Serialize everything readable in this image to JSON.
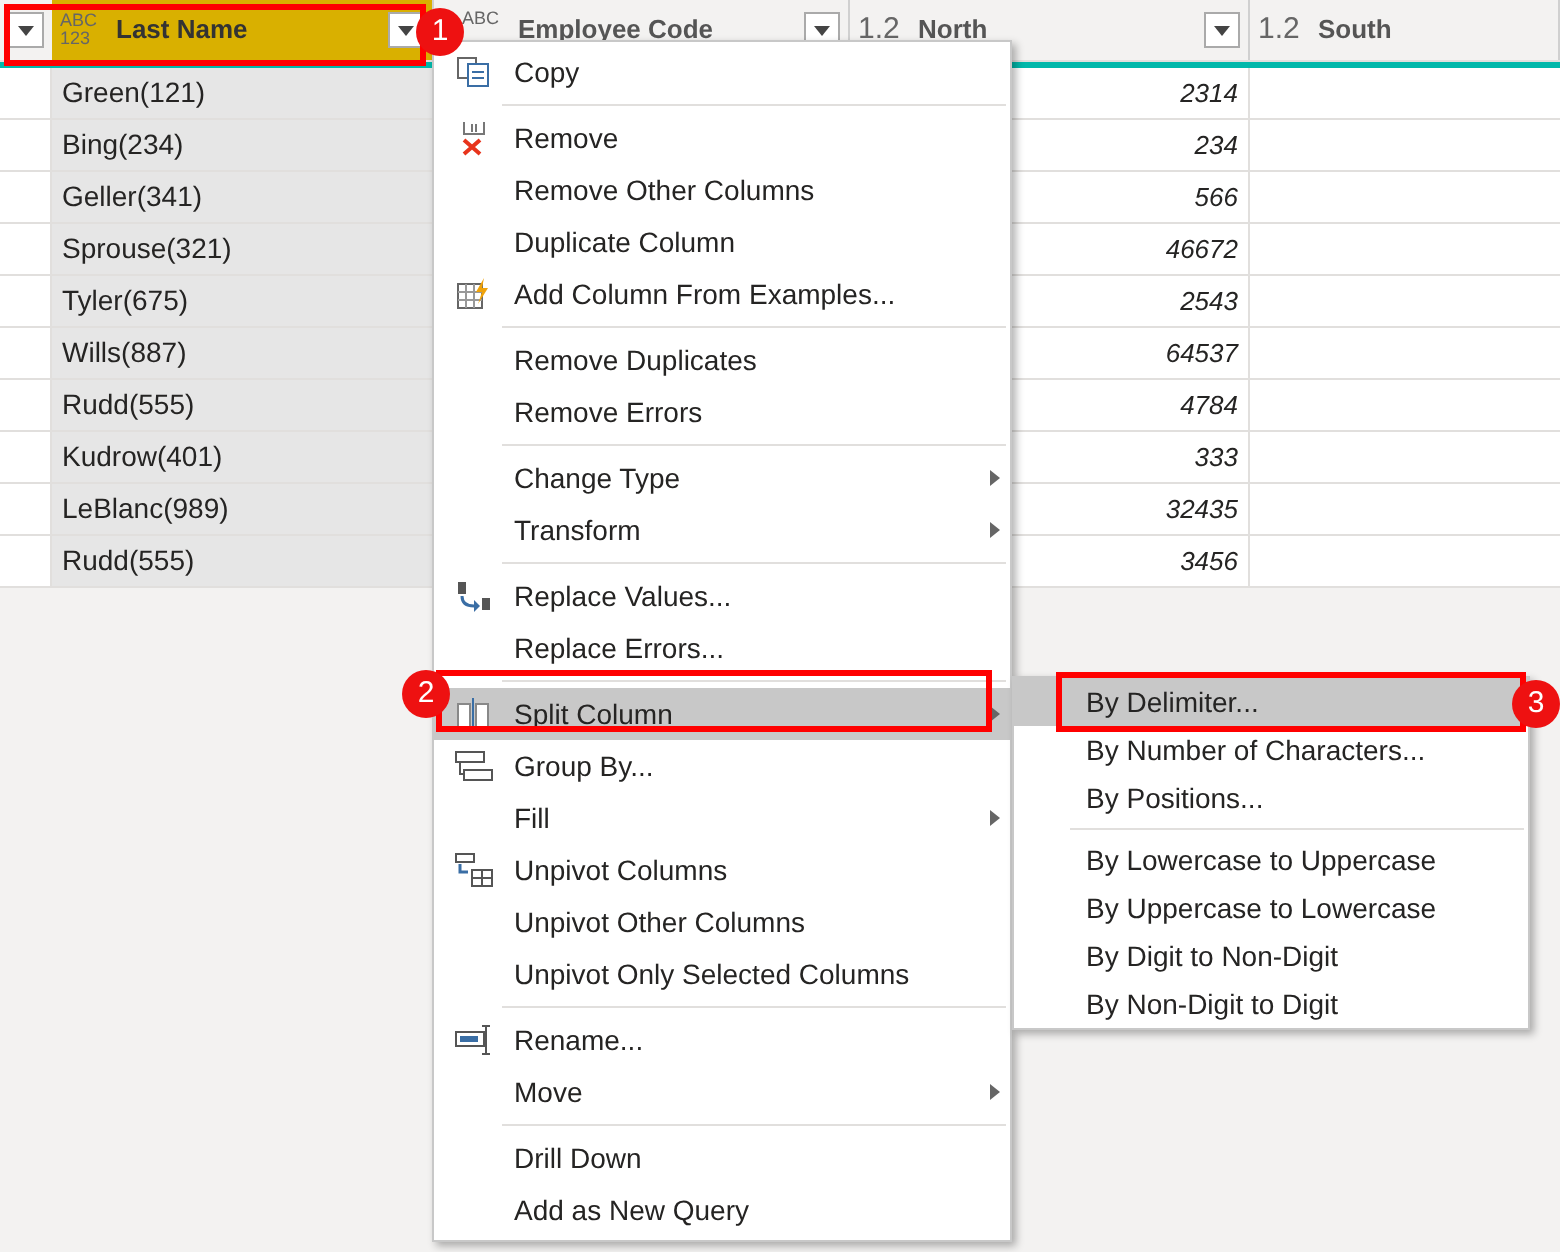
{
  "columns": [
    {
      "type_label": "ABC\n123",
      "name": "Last Name",
      "selected": true
    },
    {
      "type_label": "ABC",
      "name": "Employee Code",
      "selected": false
    },
    {
      "type_label": "1.2",
      "name": "North",
      "selected": false
    },
    {
      "type_label": "1.2",
      "name": "South",
      "selected": false
    }
  ],
  "rows": [
    {
      "last_name": "Green(121)",
      "north": "2314"
    },
    {
      "last_name": "Bing(234)",
      "north": "234"
    },
    {
      "last_name": "Geller(341)",
      "north": "566"
    },
    {
      "last_name": "Sprouse(321)",
      "north": "46672"
    },
    {
      "last_name": "Tyler(675)",
      "north": "2543"
    },
    {
      "last_name": "Wills(887)",
      "north": "64537"
    },
    {
      "last_name": "Rudd(555)",
      "north": "4784"
    },
    {
      "last_name": "Kudrow(401)",
      "north": "333"
    },
    {
      "last_name": "LeBlanc(989)",
      "north": "32435"
    },
    {
      "last_name": "Rudd(555)",
      "north": "3456"
    }
  ],
  "context_menu": [
    {
      "kind": "item",
      "label": "Copy",
      "has_submenu": false,
      "selected": false
    },
    {
      "kind": "separator"
    },
    {
      "kind": "item",
      "label": "Remove",
      "has_submenu": false,
      "selected": false
    },
    {
      "kind": "item",
      "label": "Remove Other Columns",
      "has_submenu": false,
      "selected": false
    },
    {
      "kind": "item",
      "label": "Duplicate Column",
      "has_submenu": false,
      "selected": false
    },
    {
      "kind": "item",
      "label": "Add Column From Examples...",
      "has_submenu": false,
      "selected": false
    },
    {
      "kind": "separator"
    },
    {
      "kind": "item",
      "label": "Remove Duplicates",
      "has_submenu": false,
      "selected": false
    },
    {
      "kind": "item",
      "label": "Remove Errors",
      "has_submenu": false,
      "selected": false
    },
    {
      "kind": "separator"
    },
    {
      "kind": "item",
      "label": "Change Type",
      "has_submenu": true,
      "selected": false
    },
    {
      "kind": "item",
      "label": "Transform",
      "has_submenu": true,
      "selected": false
    },
    {
      "kind": "separator"
    },
    {
      "kind": "item",
      "label": "Replace Values...",
      "has_submenu": false,
      "selected": false
    },
    {
      "kind": "item",
      "label": "Replace Errors...",
      "has_submenu": false,
      "selected": false
    },
    {
      "kind": "separator"
    },
    {
      "kind": "item",
      "label": "Split Column",
      "has_submenu": true,
      "selected": true
    },
    {
      "kind": "item",
      "label": "Group By...",
      "has_submenu": false,
      "selected": false
    },
    {
      "kind": "item",
      "label": "Fill",
      "has_submenu": true,
      "selected": false
    },
    {
      "kind": "item",
      "label": "Unpivot Columns",
      "has_submenu": false,
      "selected": false
    },
    {
      "kind": "item",
      "label": "Unpivot Other Columns",
      "has_submenu": false,
      "selected": false
    },
    {
      "kind": "item",
      "label": "Unpivot Only Selected Columns",
      "has_submenu": false,
      "selected": false
    },
    {
      "kind": "separator"
    },
    {
      "kind": "item",
      "label": "Rename...",
      "has_submenu": false,
      "selected": false
    },
    {
      "kind": "item",
      "label": "Move",
      "has_submenu": true,
      "selected": false
    },
    {
      "kind": "separator"
    },
    {
      "kind": "item",
      "label": "Drill Down",
      "has_submenu": false,
      "selected": false
    },
    {
      "kind": "item",
      "label": "Add as New Query",
      "has_submenu": false,
      "selected": false
    }
  ],
  "submenu": [
    {
      "kind": "item",
      "label": "By Delimiter...",
      "selected": true
    },
    {
      "kind": "item",
      "label": "By Number of Characters...",
      "selected": false
    },
    {
      "kind": "item",
      "label": "By Positions...",
      "selected": false
    },
    {
      "kind": "separator"
    },
    {
      "kind": "item",
      "label": "By Lowercase to Uppercase",
      "selected": false
    },
    {
      "kind": "item",
      "label": "By Uppercase to Lowercase",
      "selected": false
    },
    {
      "kind": "item",
      "label": "By Digit to Non-Digit",
      "selected": false
    },
    {
      "kind": "item",
      "label": "By Non-Digit to Digit",
      "selected": false
    }
  ],
  "callouts": [
    {
      "number": "1"
    },
    {
      "number": "2"
    },
    {
      "number": "3"
    }
  ]
}
